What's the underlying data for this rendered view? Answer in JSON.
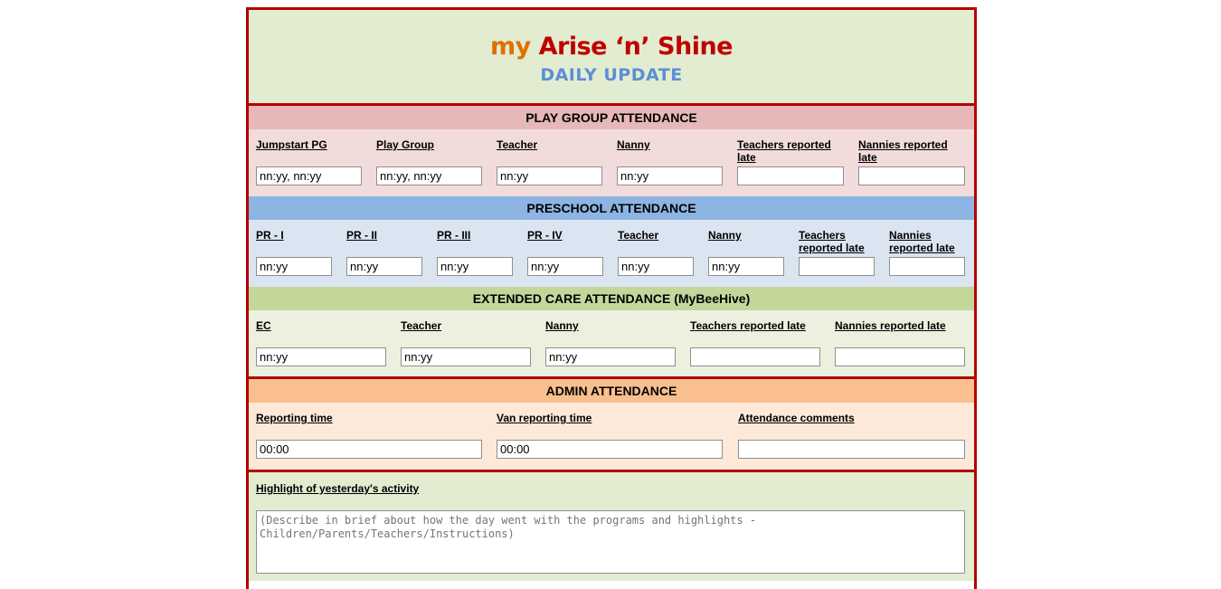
{
  "header": {
    "title_my": "my",
    "title_main": "Arise ‘n’ Shine",
    "subtitle": "DAILY UPDATE"
  },
  "playgroup": {
    "heading": "PLAY GROUP ATTENDANCE",
    "fields": [
      {
        "label": "Jumpstart PG",
        "value": "nn:yy, nn:yy"
      },
      {
        "label": "Play Group",
        "value": "nn:yy, nn:yy"
      },
      {
        "label": "Teacher",
        "value": "nn:yy"
      },
      {
        "label": "Nanny",
        "value": "nn:yy"
      },
      {
        "label": "Teachers reported late",
        "value": ""
      },
      {
        "label": "Nannies reported late",
        "value": ""
      }
    ]
  },
  "preschool": {
    "heading": "PRESCHOOL ATTENDANCE",
    "fields": [
      {
        "label": "PR - I",
        "value": "nn:yy"
      },
      {
        "label": "PR - II",
        "value": "nn:yy"
      },
      {
        "label": "PR - III",
        "value": "nn:yy"
      },
      {
        "label": "PR - IV",
        "value": "nn:yy"
      },
      {
        "label": "Teacher",
        "value": "nn:yy"
      },
      {
        "label": "Nanny",
        "value": "nn:yy"
      },
      {
        "label": "Teachers reported late",
        "value": ""
      },
      {
        "label": "Nannies reported late",
        "value": ""
      }
    ]
  },
  "extended": {
    "heading": "EXTENDED CARE ATTENDANCE (MyBeeHive)",
    "fields": [
      {
        "label": "EC",
        "value": "nn:yy"
      },
      {
        "label": "Teacher",
        "value": "nn:yy"
      },
      {
        "label": "Nanny",
        "value": "nn:yy"
      },
      {
        "label": "Teachers reported late",
        "value": ""
      },
      {
        "label": "Nannies reported late",
        "value": ""
      }
    ]
  },
  "admin": {
    "heading": "ADMIN ATTENDANCE",
    "fields": [
      {
        "label": "Reporting time",
        "value": "00:00"
      },
      {
        "label": "Van reporting time",
        "value": "00:00"
      },
      {
        "label": "Attendance comments",
        "value": ""
      }
    ]
  },
  "highlight": {
    "label": "Highlight of yesterday's activity",
    "placeholder": "(Describe in brief about how the day went with the programs and highlights - Children/Parents/Teachers/Instructions)"
  },
  "colors": {
    "border": "#b30000",
    "title_my": "#e07000",
    "title_main": "#c00000",
    "subtitle": "#5b8fd6"
  }
}
